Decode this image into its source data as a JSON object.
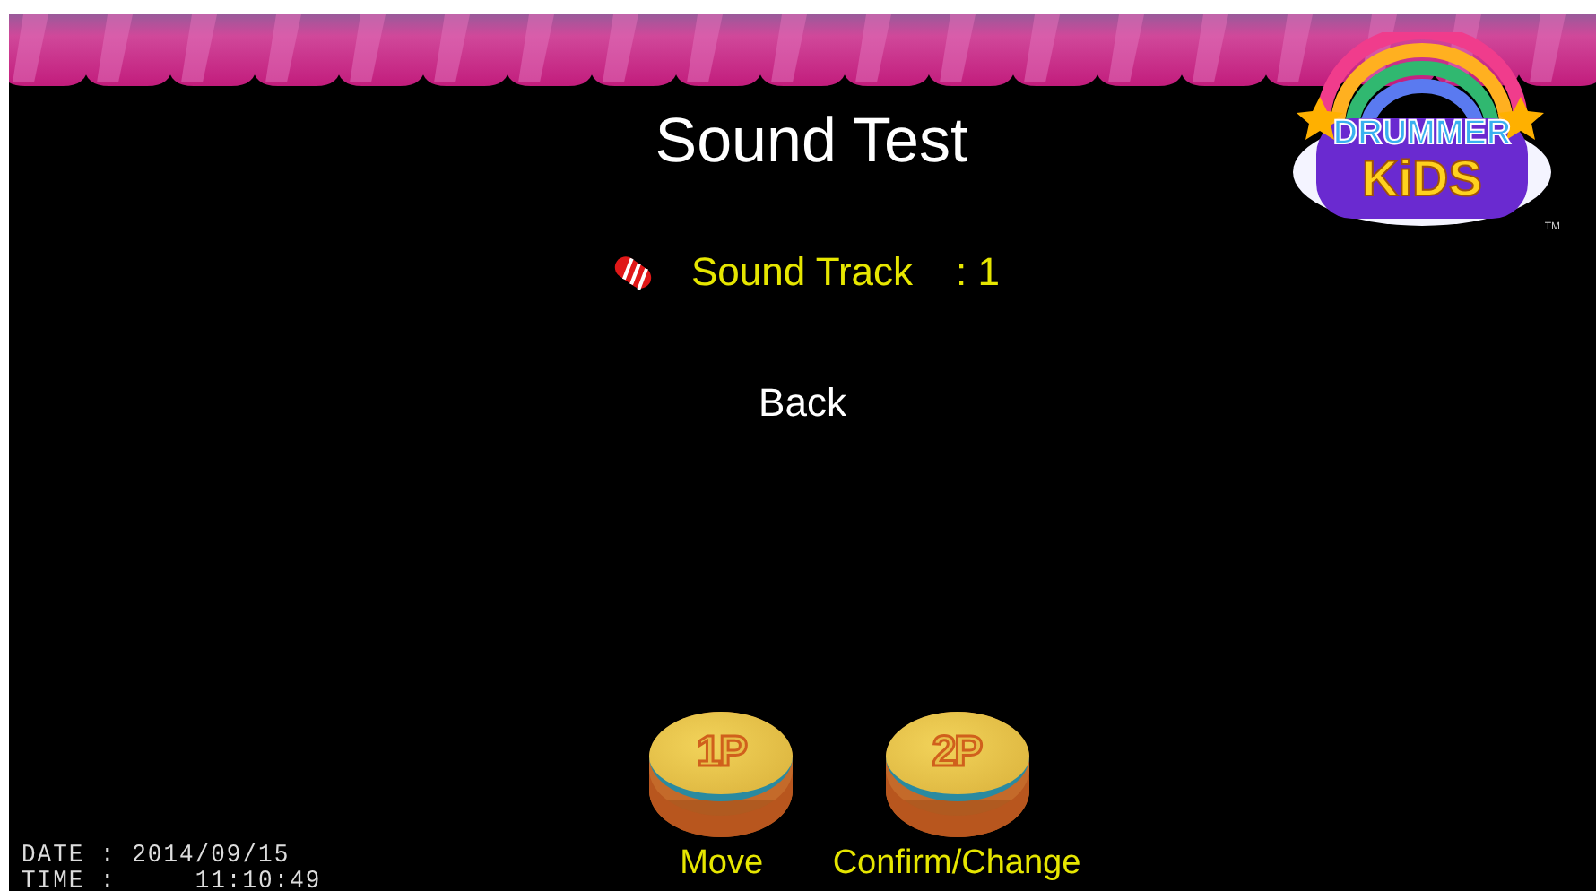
{
  "title": "Sound Test",
  "logo": {
    "line_1": "DRUMMER",
    "line_2": "KiDS",
    "trademark": "TM"
  },
  "menu": [
    {
      "label": "Sound Track",
      "separator": ":",
      "value": "1",
      "selected": true
    },
    {
      "label": "Back",
      "selected": false
    }
  ],
  "controls": [
    {
      "button": "1P",
      "caption": "Move"
    },
    {
      "button": "2P",
      "caption": "Confirm/Change"
    }
  ],
  "clock": {
    "date": "DATE : 2014/09/15",
    "time": "TIME :     11:10:49"
  }
}
